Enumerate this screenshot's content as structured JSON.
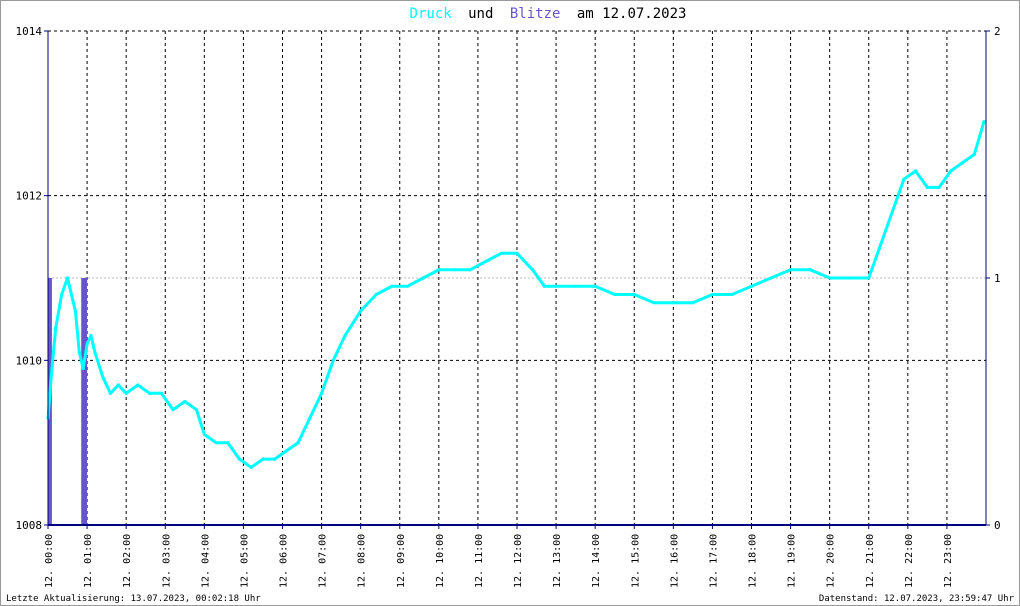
{
  "chart_data": {
    "type": "line",
    "title": {
      "word1": "Druck",
      "joiner": "und",
      "word2": "Blitze",
      "suffix": "am 12.07.2023"
    },
    "colors": {
      "druck": "#00ffff",
      "blitze": "#6655cc",
      "axis": "#000080",
      "grid": "#000000",
      "text": "#000000"
    },
    "y_left": {
      "min": 1008,
      "max": 1014,
      "ticks": [
        1008,
        1010,
        1012,
        1014
      ]
    },
    "y_right": {
      "min": 0,
      "max": 2,
      "ticks": [
        0,
        1,
        2
      ]
    },
    "x_range": [
      0,
      24
    ],
    "x_ticks": [
      {
        "h": 0,
        "label": "12. 00:00"
      },
      {
        "h": 1,
        "label": "12. 01:00"
      },
      {
        "h": 2,
        "label": "12. 02:00"
      },
      {
        "h": 3,
        "label": "12. 03:00"
      },
      {
        "h": 4,
        "label": "12. 04:00"
      },
      {
        "h": 5,
        "label": "12. 05:00"
      },
      {
        "h": 6,
        "label": "12. 06:00"
      },
      {
        "h": 7,
        "label": "12. 07:00"
      },
      {
        "h": 8,
        "label": "12. 08:00"
      },
      {
        "h": 9,
        "label": "12. 09:00"
      },
      {
        "h": 10,
        "label": "12. 10:00"
      },
      {
        "h": 11,
        "label": "12. 11:00"
      },
      {
        "h": 12,
        "label": "12. 12:00"
      },
      {
        "h": 13,
        "label": "12. 13:00"
      },
      {
        "h": 14,
        "label": "12. 14:00"
      },
      {
        "h": 15,
        "label": "12. 15:00"
      },
      {
        "h": 16,
        "label": "12. 16:00"
      },
      {
        "h": 17,
        "label": "12. 17:00"
      },
      {
        "h": 18,
        "label": "12. 18:00"
      },
      {
        "h": 19,
        "label": "12. 19:00"
      },
      {
        "h": 20,
        "label": "12. 20:00"
      },
      {
        "h": 21,
        "label": "12. 21:00"
      },
      {
        "h": 22,
        "label": "12. 22:00"
      },
      {
        "h": 23,
        "label": "12. 23:00"
      }
    ],
    "series": [
      {
        "name": "Druck",
        "x": [
          0,
          0.1,
          0.2,
          0.35,
          0.5,
          0.7,
          0.8,
          0.9,
          1.0,
          1.1,
          1.2,
          1.4,
          1.6,
          1.8,
          2.0,
          2.3,
          2.6,
          2.9,
          3.2,
          3.5,
          3.8,
          4.0,
          4.3,
          4.6,
          4.9,
          5.2,
          5.5,
          5.8,
          6.1,
          6.4,
          6.7,
          7.0,
          7.3,
          7.6,
          8.0,
          8.4,
          8.8,
          9.2,
          9.6,
          10.0,
          10.4,
          10.8,
          11.2,
          11.6,
          12.0,
          12.4,
          12.7,
          13.0,
          13.5,
          14.0,
          14.5,
          15.0,
          15.5,
          16.0,
          16.5,
          17.0,
          17.5,
          18.0,
          18.5,
          19.0,
          19.5,
          20.0,
          20.5,
          21.0,
          21.3,
          21.6,
          21.9,
          22.2,
          22.5,
          22.8,
          23.1,
          23.4,
          23.7,
          23.95
        ],
        "y": [
          1009.3,
          1009.9,
          1010.4,
          1010.8,
          1011.0,
          1010.6,
          1010.1,
          1009.9,
          1010.2,
          1010.3,
          1010.1,
          1009.8,
          1009.6,
          1009.7,
          1009.6,
          1009.7,
          1009.6,
          1009.6,
          1009.4,
          1009.5,
          1009.4,
          1009.1,
          1009.0,
          1009.0,
          1008.8,
          1008.7,
          1008.8,
          1008.8,
          1008.9,
          1009.0,
          1009.3,
          1009.6,
          1010.0,
          1010.3,
          1010.6,
          1010.8,
          1010.9,
          1010.9,
          1011.0,
          1011.1,
          1011.1,
          1011.1,
          1011.2,
          1011.3,
          1011.3,
          1011.1,
          1010.9,
          1010.9,
          1010.9,
          1010.9,
          1010.8,
          1010.8,
          1010.7,
          1010.7,
          1010.7,
          1010.8,
          1010.8,
          1010.9,
          1011.0,
          1011.1,
          1011.1,
          1011.0,
          1011.0,
          1011.0,
          1011.4,
          1011.8,
          1012.2,
          1012.3,
          1012.1,
          1012.1,
          1012.3,
          1012.4,
          1012.5,
          1012.9
        ]
      },
      {
        "name": "Blitze",
        "bars": [
          {
            "x0": 0.0,
            "x1": 0.1,
            "value": 1
          },
          {
            "x0": 0.85,
            "x1": 1.0,
            "value": 1
          }
        ]
      }
    ]
  },
  "footer": {
    "left": "Letzte Aktualisierung: 13.07.2023, 00:02:18 Uhr",
    "right": "Datenstand: 12.07.2023, 23:59:47 Uhr"
  }
}
